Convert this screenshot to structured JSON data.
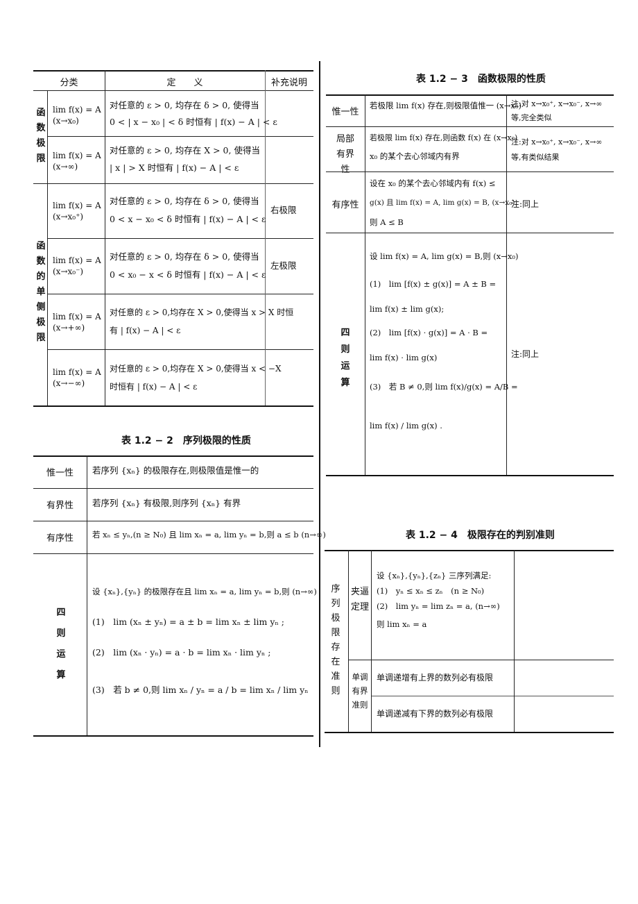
{
  "table_1_2_1": {
    "headers": {
      "category": "分类",
      "definition": "定　　义",
      "note": "补充说明"
    },
    "group_function_limit": "函数极限",
    "group_one_sided": "函数的单侧极限",
    "rows": [
      {
        "formula": "lim f(x) = A  (x→x₀)",
        "def_line1": "对任意的 ε > 0, 均存在 δ > 0, 使得当",
        "def_line2": "0 < | x − x₀ | < δ 时恒有 | f(x) − A | < ε",
        "note": ""
      },
      {
        "formula": "lim f(x) = A  (x→∞)",
        "def_line1": "对任意的 ε > 0, 均存在 X > 0, 使得当",
        "def_line2": "| x | > X 时恒有 | f(x) − A | < ε",
        "note": ""
      },
      {
        "formula": "lim f(x) = A  (x→x₀⁺)",
        "def_line1": "对任意的 ε > 0, 均存在 δ > 0, 使得当",
        "def_line2": "0 < x − x₀ < δ 时恒有 | f(x) − A | < ε",
        "note": "右极限"
      },
      {
        "formula": "lim f(x) = A  (x→x₀⁻)",
        "def_line1": "对任意的 ε > 0, 均存在 δ > 0, 使得当",
        "def_line2": "0 < x₀ − x < δ 时恒有 | f(x) − A | < ε",
        "note": "左极限"
      },
      {
        "formula": "lim f(x) = A  (x→+∞)",
        "def_line1": "对任意的 ε > 0,均存在 X > 0,使得当 x > X 时恒",
        "def_line2": "有 | f(x) − A | < ε",
        "note": ""
      },
      {
        "formula": "lim f(x) = A  (x→−∞)",
        "def_line1": "对任意的 ε > 0,均存在 X > 0,使得当 x < −X",
        "def_line2": "时恒有 | f(x) − A | < ε",
        "note": ""
      }
    ]
  },
  "table_1_2_2": {
    "caption": "表 1.2 − 2　序列极限的性质",
    "rows": [
      {
        "label": "惟一性",
        "content": "若序列 {xₙ} 的极限存在,则极限值是惟一的"
      },
      {
        "label": "有界性",
        "content": "若序列 {xₙ} 有极限,则序列 {xₙ} 有界"
      },
      {
        "label": "有序性",
        "content": "若 xₙ ≤ yₙ,(n ≥ N₀) 且 lim xₙ = a, lim yₙ = b,则 a ≤ b  (n→∞)"
      }
    ],
    "arith": {
      "label": "四则运算",
      "lines": [
        "设 {xₙ},{yₙ} 的极限存在且 lim xₙ = a, lim yₙ = b,则  (n→∞)",
        "(1)　lim (xₙ ± yₙ) = a ± b = lim xₙ ± lim yₙ ;",
        "(2)　lim (xₙ · yₙ) = a · b = lim xₙ · lim yₙ ;",
        "(3)　若 b ≠ 0,则 lim xₙ / yₙ = a / b = lim xₙ / lim yₙ"
      ]
    }
  },
  "table_1_2_3": {
    "caption": "表 1.2 − 3　函数极限的性质",
    "rows": [
      {
        "label": "惟一性",
        "content_lines": [
          "若极限 lim f(x) 存在,则极限值惟一  (x→x₀)"
        ],
        "note_lines": [
          "注:对 x→x₀⁺, x→x₀⁻, x→∞",
          "等,完全类似"
        ]
      },
      {
        "label": "局部有界性",
        "content_lines": [
          "若极限 lim f(x) 存在,则函数 f(x) 在  (x→x₀)",
          "x₀ 的某个去心邻域内有界"
        ],
        "note_lines": [
          "注:对 x→x₀⁺, x→x₀⁻, x→∞",
          "等,有类似结果"
        ]
      },
      {
        "label": "有序性",
        "content_lines": [
          "设在 x₀ 的某个去心邻域内有 f(x) ≤",
          "g(x) 且 lim f(x) = A, lim g(x) = B,  (x→x₀)",
          "则 A ≤ B"
        ],
        "note_lines": [
          "注:同上"
        ]
      }
    ],
    "arith": {
      "label": "四则运算",
      "lines": [
        "设 lim f(x) = A, lim g(x) = B,则  (x→x₀)",
        "(1)　lim [f(x) ± g(x)] = A ± B =",
        "lim f(x) ± lim g(x);",
        "(2)　lim [f(x) · g(x)] = A · B =",
        "lim f(x) · lim g(x)",
        "(3)　若 B ≠ 0,则 lim f(x)/g(x) = A/B =",
        "lim f(x) / lim g(x) ."
      ],
      "note": "注:同上"
    }
  },
  "table_1_2_4": {
    "caption": "表 1.2 − 4　极限存在的判别准则",
    "group": "序列极限存在准则",
    "squeeze": {
      "label": "夹逼定理",
      "lines": [
        "设 {xₙ},{yₙ},{zₙ} 三序列满足:",
        "(1)　yₙ ≤ xₙ ≤ zₙ　(n ≥ N₀)",
        "(2)　lim yₙ = lim zₙ = a,  (n→∞)",
        "则 lim xₙ = a"
      ]
    },
    "monotone": {
      "label": "单调有界准则",
      "lines": [
        "单调递增有上界的数列必有极限",
        "单调递减有下界的数列必有极限"
      ]
    }
  }
}
